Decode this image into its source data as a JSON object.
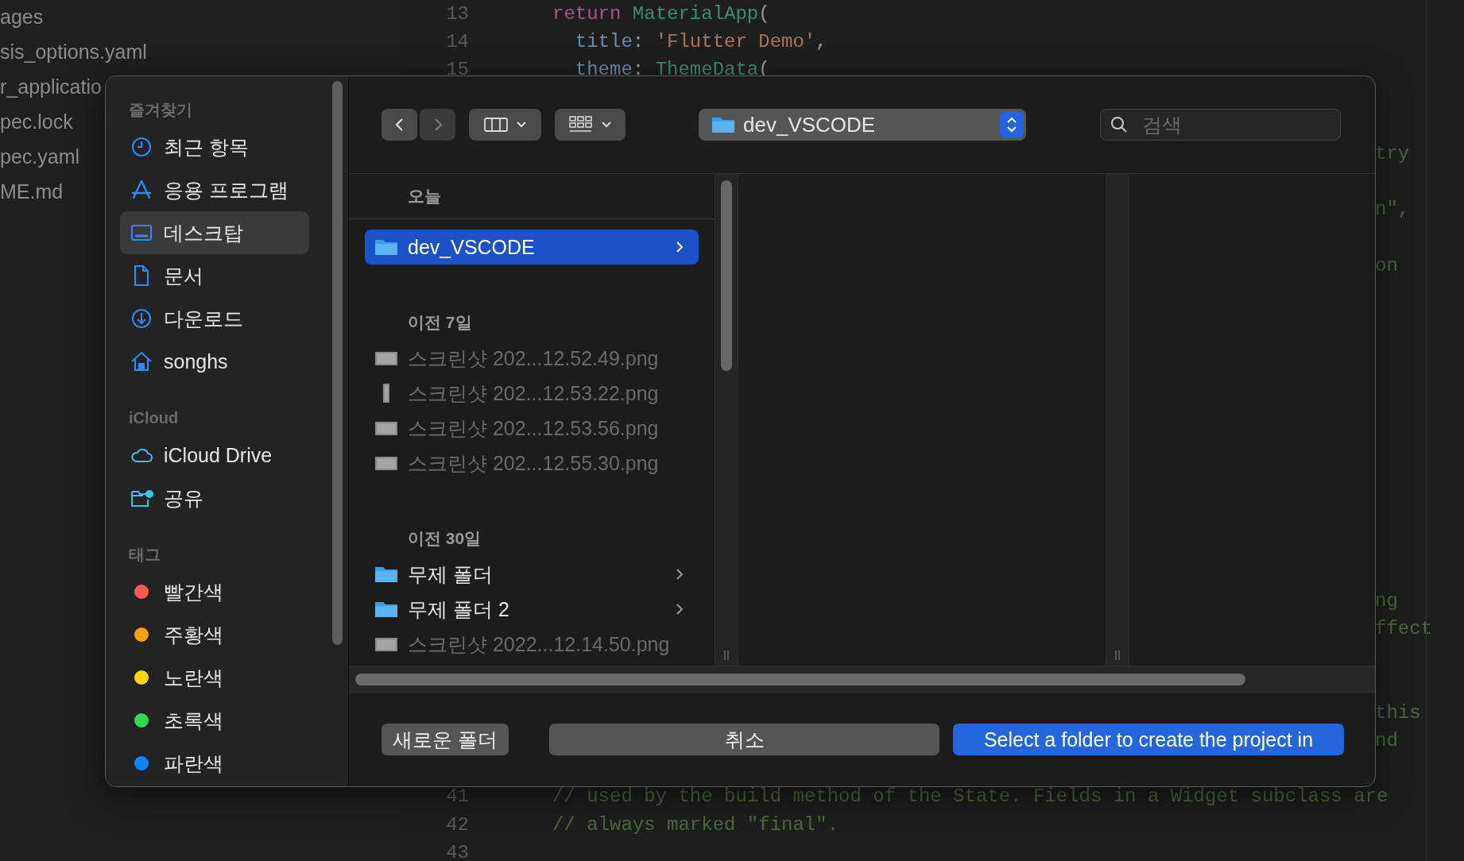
{
  "explorer": {
    "items": [
      "ages",
      "sis_options.yaml",
      "r_applicatio",
      "pec.lock",
      "pec.yaml",
      "ME.md"
    ]
  },
  "editor": {
    "lines": [
      {
        "number": "13",
        "tokens": [
          {
            "kind": "keyword",
            "text": "return "
          },
          {
            "kind": "class",
            "text": "MaterialApp"
          },
          {
            "kind": "plain",
            "text": "("
          }
        ]
      },
      {
        "number": "14",
        "tokens": [
          {
            "kind": "property",
            "text": "  title"
          },
          {
            "kind": "plain",
            "text": ": "
          },
          {
            "kind": "string",
            "text": "'Flutter Demo'"
          },
          {
            "kind": "plain",
            "text": ","
          }
        ]
      },
      {
        "number": "15",
        "tokens": [
          {
            "kind": "property",
            "text": "  theme"
          },
          {
            "kind": "plain",
            "text": ": "
          },
          {
            "kind": "class",
            "text": "ThemeData"
          },
          {
            "kind": "plain",
            "text": "("
          }
        ]
      },
      {
        "tokens": [
          {
            "kind": "comment",
            "text": "try"
          }
        ]
      },
      {
        "tokens": [
          {
            "kind": "comment",
            "text": "n\","
          }
        ]
      },
      {
        "tokens": [
          {
            "kind": "comment",
            "text": "on"
          }
        ]
      },
      {
        "tokens": [
          {
            "kind": "comment",
            "text": "ng"
          }
        ]
      },
      {
        "tokens": [
          {
            "kind": "comment",
            "text": "ffect"
          }
        ]
      },
      {
        "tokens": [
          {
            "kind": "comment",
            "text": "this"
          }
        ]
      },
      {
        "tokens": [
          {
            "kind": "comment",
            "text": "nd"
          }
        ]
      },
      {
        "number": "41",
        "tokens": [
          {
            "kind": "comment",
            "text": "// used by the build method of the State. Fields in a Widget subclass are"
          }
        ]
      },
      {
        "number": "42",
        "tokens": [
          {
            "kind": "comment",
            "text": "// always marked \"final\"."
          }
        ]
      },
      {
        "number": "43"
      }
    ]
  },
  "dialog": {
    "sidebar": {
      "sections": [
        {
          "header": "즐겨찾기",
          "items": [
            {
              "label": "최근 항목",
              "selected": false
            },
            {
              "label": "응용 프로그램",
              "selected": false
            },
            {
              "label": "데스크탑",
              "selected": true
            },
            {
              "label": "문서",
              "selected": false
            },
            {
              "label": "다운로드",
              "selected": false
            },
            {
              "label": "songhs",
              "selected": false
            }
          ]
        },
        {
          "header": "iCloud",
          "items": [
            {
              "label": "iCloud Drive",
              "selected": false
            },
            {
              "label": "공유",
              "selected": false
            }
          ]
        },
        {
          "header": "태그",
          "items": [
            {
              "label": "빨간색",
              "selected": false,
              "color": "#fe5a50"
            },
            {
              "label": "주황색",
              "selected": false,
              "color": "#ff9f0a"
            },
            {
              "label": "노란색",
              "selected": false,
              "color": "#ffd60a"
            },
            {
              "label": "초록색",
              "selected": false,
              "color": "#32d74b"
            },
            {
              "label": "파란색",
              "selected": false,
              "color": "#0a84ff"
            }
          ]
        }
      ]
    },
    "toolbar": {
      "back_disabled": false,
      "forward_disabled": true,
      "location": "dev_VSCODE",
      "search": {
        "placeholder": "검색"
      }
    },
    "column": {
      "sections": [
        {
          "header": "오늘",
          "items": [
            {
              "label": "dev_VSCODE",
              "kind": "folder",
              "selected": true,
              "disabled": false
            }
          ]
        },
        {
          "header": "이전 7일",
          "items": [
            {
              "label": "스크린샷 202...12.52.49.png",
              "kind": "image",
              "selected": false,
              "disabled": true
            },
            {
              "label": "스크린샷 202...12.53.22.png",
              "kind": "tall-image",
              "selected": false,
              "disabled": true
            },
            {
              "label": "스크린샷 202...12.53.56.png",
              "kind": "image",
              "selected": false,
              "disabled": true
            },
            {
              "label": "스크린샷 202...12.55.30.png",
              "kind": "image",
              "selected": false,
              "disabled": true
            }
          ]
        },
        {
          "header": "이전 30일",
          "items": [
            {
              "label": "무제 폴더",
              "kind": "folder",
              "selected": false,
              "disabled": false
            },
            {
              "label": "무제 폴더 2",
              "kind": "folder",
              "selected": false,
              "disabled": false
            },
            {
              "label": "스크린샷 2022...12.14.50.png",
              "kind": "image",
              "selected": false,
              "disabled": true
            }
          ]
        }
      ]
    },
    "buttons": [
      {
        "label": "새로운 폴더",
        "kind": "secondary"
      },
      {
        "label": "취소",
        "kind": "secondary"
      },
      {
        "label": "Select a folder to create the project in",
        "kind": "primary"
      }
    ]
  }
}
